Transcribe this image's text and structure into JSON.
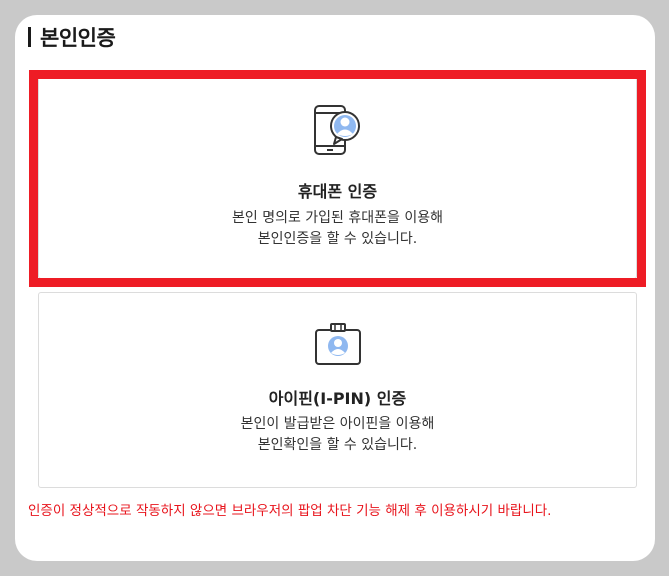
{
  "section": {
    "title": "본인인증"
  },
  "phone_auth": {
    "icon": "smartphone-user-icon",
    "title": "휴대폰 인증",
    "desc_line1": "본인 명의로 가입된 휴대폰을 이용해",
    "desc_line2": "본인인증을 할 수 있습니다."
  },
  "ipin_auth": {
    "icon": "id-badge-icon",
    "title": "아이핀(I-PIN) 인증",
    "desc_line1": "본인이 발급받은 아이핀을 이용해",
    "desc_line2": "본인확인을 할 수 있습니다."
  },
  "notice": "인증이 정상적으로 작동하지 않으면 브라우저의 팝업 차단 기능 해제 후 이용하시기 바랍니다.",
  "colors": {
    "highlight": "#ee1c25",
    "notice_text": "#e8141c",
    "icon_accent": "#8fb8f0"
  }
}
